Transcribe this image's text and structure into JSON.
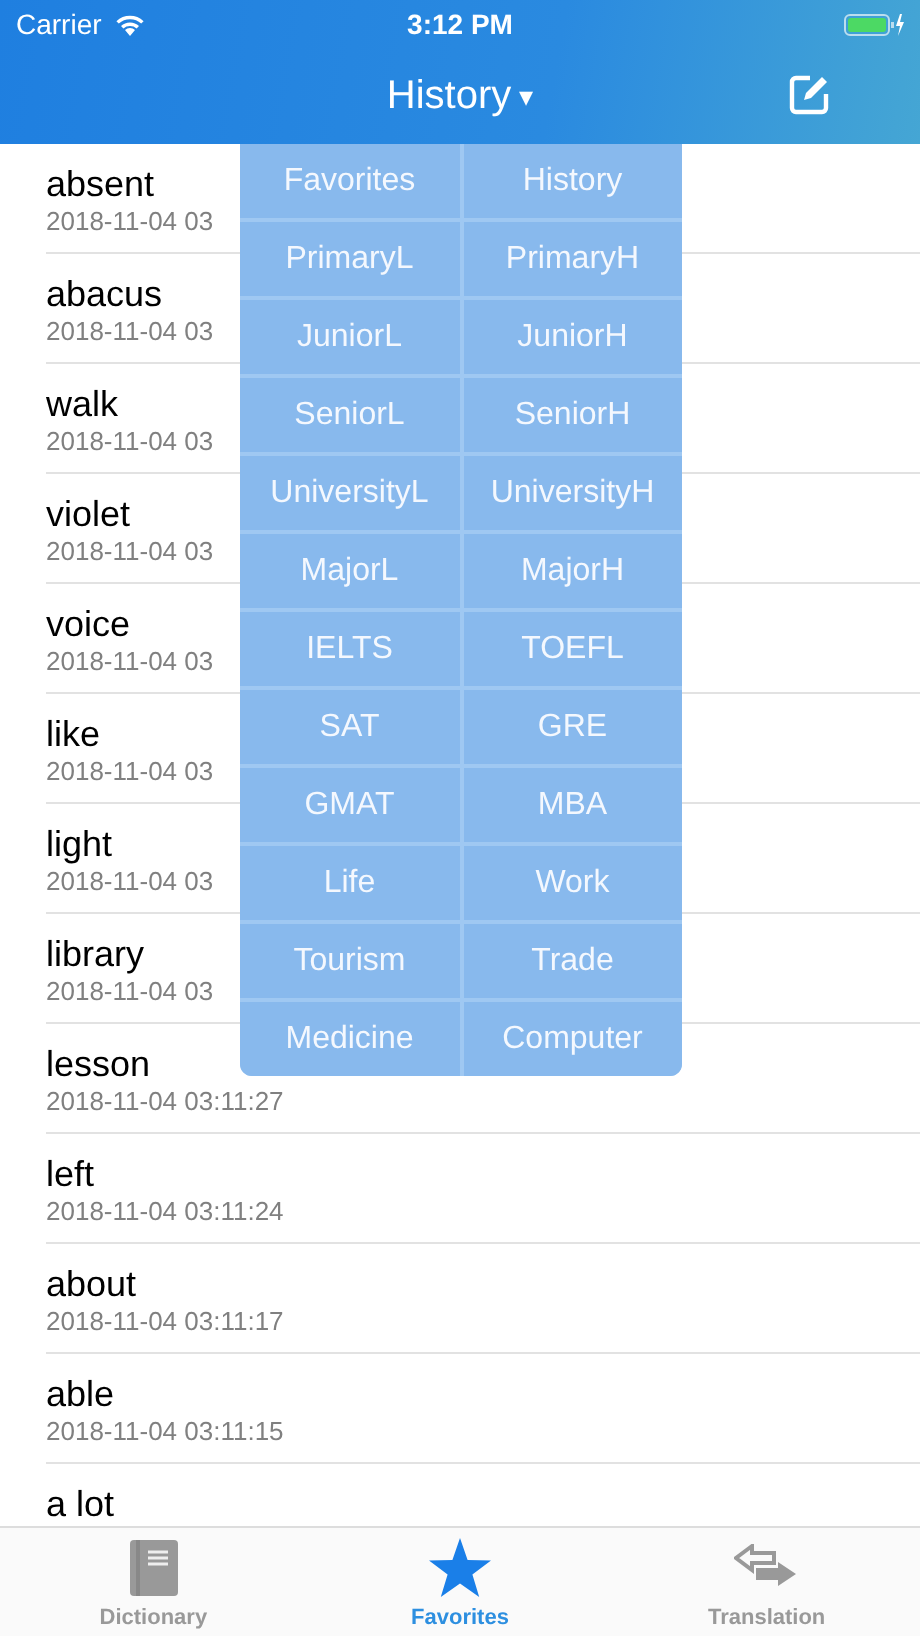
{
  "status_bar": {
    "carrier": "Carrier",
    "time": "3:12 PM"
  },
  "nav": {
    "title": "History",
    "caret": "▾"
  },
  "words": [
    {
      "word": "absent",
      "date": "2018-11-04 03"
    },
    {
      "word": "abacus",
      "date": "2018-11-04 03"
    },
    {
      "word": "walk",
      "date": "2018-11-04 03"
    },
    {
      "word": "violet",
      "date": "2018-11-04 03"
    },
    {
      "word": "voice",
      "date": "2018-11-04 03"
    },
    {
      "word": "like",
      "date": "2018-11-04 03"
    },
    {
      "word": "light",
      "date": "2018-11-04 03"
    },
    {
      "word": "library",
      "date": "2018-11-04 03"
    },
    {
      "word": "lesson",
      "date": "2018-11-04 03:11:27"
    },
    {
      "word": "left",
      "date": "2018-11-04 03:11:24"
    },
    {
      "word": "about",
      "date": "2018-11-04 03:11:17"
    },
    {
      "word": "able",
      "date": "2018-11-04 03:11:15"
    },
    {
      "word": "a lot"
    }
  ],
  "menu": [
    "Favorites",
    "History",
    "PrimaryL",
    "PrimaryH",
    "JuniorL",
    "JuniorH",
    "SeniorL",
    "SeniorH",
    "UniversityL",
    "UniversityH",
    "MajorL",
    "MajorH",
    "IELTS",
    "TOEFL",
    "SAT",
    "GRE",
    "GMAT",
    "MBA",
    "Life",
    "Work",
    "Tourism",
    "Trade",
    "Medicine",
    "Computer"
  ],
  "tabs": [
    {
      "kind": "book",
      "label": "Dictionary",
      "selected": false
    },
    {
      "kind": "star",
      "label": "Favorites",
      "selected": true
    },
    {
      "kind": "arrows",
      "label": "Translation",
      "selected": false
    }
  ]
}
